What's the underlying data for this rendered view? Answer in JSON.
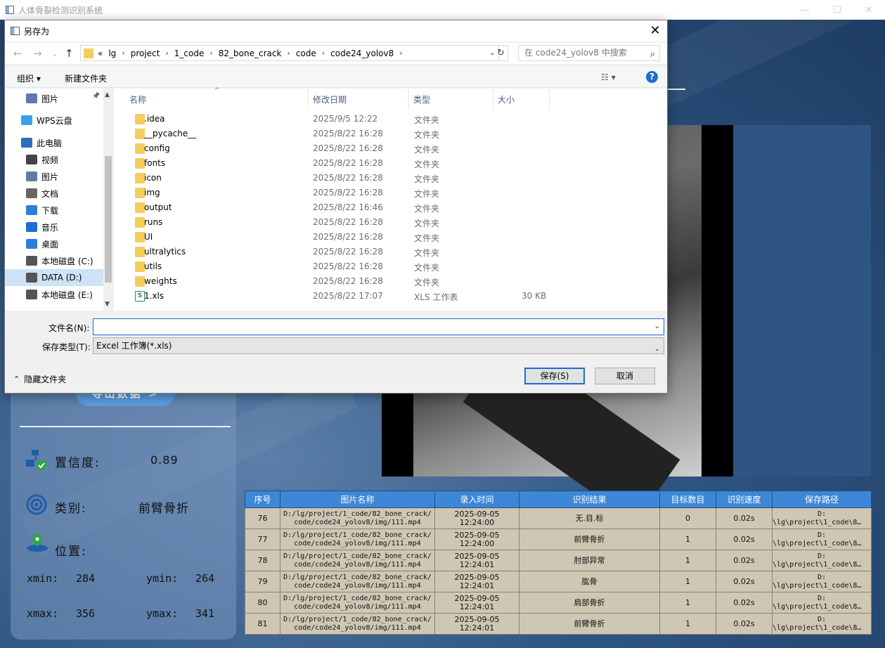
{
  "app": {
    "title": "人体骨裂检测识别系统"
  },
  "left": {
    "export_label": "导出数据 >",
    "confidence_label": "置信度:",
    "confidence_value": "0.89",
    "class_label": "类别:",
    "class_value": "前臂骨折",
    "position_label": "位置:",
    "xmin_label": "xmin:",
    "xmin_value": "284",
    "ymin_label": "ymin:",
    "ymin_value": "264",
    "xmax_label": "xmax:",
    "xmax_value": "356",
    "ymax_label": "ymax:",
    "ymax_value": "341"
  },
  "table": {
    "headers": [
      "序号",
      "图片名称",
      "录入时间",
      "识别结果",
      "目标数目",
      "识别速度",
      "保存路径"
    ],
    "rows": [
      {
        "id": "76",
        "name1": "D:/lg/project/1_code/82_bone_crack/",
        "name2": "code/code24_yolov8/img/111.mp4",
        "time1": "2025-09-05",
        "time2": "12:24:00",
        "result": "无.目.标",
        "count": "0",
        "speed": "0.02s",
        "path1": "D:",
        "path2": "\\lg\\project\\1_code\\8…"
      },
      {
        "id": "77",
        "name1": "D:/lg/project/1_code/82_bone_crack/",
        "name2": "code/code24_yolov8/img/111.mp4",
        "time1": "2025-09-05",
        "time2": "12:24:00",
        "result": "前臂骨折",
        "count": "1",
        "speed": "0.02s",
        "path1": "D:",
        "path2": "\\lg\\project\\1_code\\8…"
      },
      {
        "id": "78",
        "name1": "D:/lg/project/1_code/82_bone_crack/",
        "name2": "code/code24_yolov8/img/111.mp4",
        "time1": "2025-09-05",
        "time2": "12:24:01",
        "result": "肘部异常",
        "count": "1",
        "speed": "0.02s",
        "path1": "D:",
        "path2": "\\lg\\project\\1_code\\8…"
      },
      {
        "id": "79",
        "name1": "D:/lg/project/1_code/82_bone_crack/",
        "name2": "code/code24_yolov8/img/111.mp4",
        "time1": "2025-09-05",
        "time2": "12:24:01",
        "result": "肱骨",
        "count": "1",
        "speed": "0.02s",
        "path1": "D:",
        "path2": "\\lg\\project\\1_code\\8…"
      },
      {
        "id": "80",
        "name1": "D:/lg/project/1_code/82_bone_crack/",
        "name2": "code/code24_yolov8/img/111.mp4",
        "time1": "2025-09-05",
        "time2": "12:24:01",
        "result": "肩部骨折",
        "count": "1",
        "speed": "0.02s",
        "path1": "D:",
        "path2": "\\lg\\project\\1_code\\8…"
      },
      {
        "id": "81",
        "name1": "D:/lg/project/1_code/82_bone_crack/",
        "name2": "code/code24_yolov8/img/111.mp4",
        "time1": "2025-09-05",
        "time2": "12:24:01",
        "result": "前臂骨折",
        "count": "1",
        "speed": "0.02s",
        "path1": "D:",
        "path2": "\\lg\\project\\1_code\\8…"
      }
    ]
  },
  "dialog": {
    "title": "另存为",
    "breadcrumbs": [
      "«",
      "lg",
      "project",
      "1_code",
      "82_bone_crack",
      "code",
      "code24_yolov8"
    ],
    "search_placeholder": "在 code24_yolov8 中搜索",
    "organize_label": "组织 ▾",
    "new_folder_label": "新建文件夹",
    "nav_items": [
      "图片",
      "WPS云盘",
      "此电脑",
      "视频",
      "图片",
      "文档",
      "下载",
      "音乐",
      "桌面",
      "本地磁盘 (C:)",
      "DATA (D:)",
      "本地磁盘 (E:)"
    ],
    "columns": [
      "名称",
      "修改日期",
      "类型",
      "大小"
    ],
    "files": [
      {
        "name": ".idea",
        "date": "2025/9/5 12:22",
        "type": "文件夹",
        "size": ""
      },
      {
        "name": "__pycache__",
        "date": "2025/8/22 16:28",
        "type": "文件夹",
        "size": ""
      },
      {
        "name": "config",
        "date": "2025/8/22 16:28",
        "type": "文件夹",
        "size": ""
      },
      {
        "name": "fonts",
        "date": "2025/8/22 16:28",
        "type": "文件夹",
        "size": ""
      },
      {
        "name": "icon",
        "date": "2025/8/22 16:28",
        "type": "文件夹",
        "size": ""
      },
      {
        "name": "img",
        "date": "2025/8/22 16:28",
        "type": "文件夹",
        "size": ""
      },
      {
        "name": "output",
        "date": "2025/8/22 16:46",
        "type": "文件夹",
        "size": ""
      },
      {
        "name": "runs",
        "date": "2025/8/22 16:28",
        "type": "文件夹",
        "size": ""
      },
      {
        "name": "UI",
        "date": "2025/8/22 16:28",
        "type": "文件夹",
        "size": ""
      },
      {
        "name": "ultralytics",
        "date": "2025/8/22 16:28",
        "type": "文件夹",
        "size": ""
      },
      {
        "name": "utils",
        "date": "2025/8/22 16:28",
        "type": "文件夹",
        "size": ""
      },
      {
        "name": "weights",
        "date": "2025/8/22 16:28",
        "type": "文件夹",
        "size": ""
      },
      {
        "name": "1.xls",
        "date": "2025/8/22 17:07",
        "type": "XLS 工作表",
        "size": "30 KB"
      }
    ],
    "filename_label": "文件名(N):",
    "filename_value": "",
    "filetype_label": "保存类型(T):",
    "filetype_value": "Excel 工作簿(*.xls)",
    "save_label": "保存(S)",
    "cancel_label": "取消",
    "hide_folders_label": "隐藏文件夹"
  }
}
